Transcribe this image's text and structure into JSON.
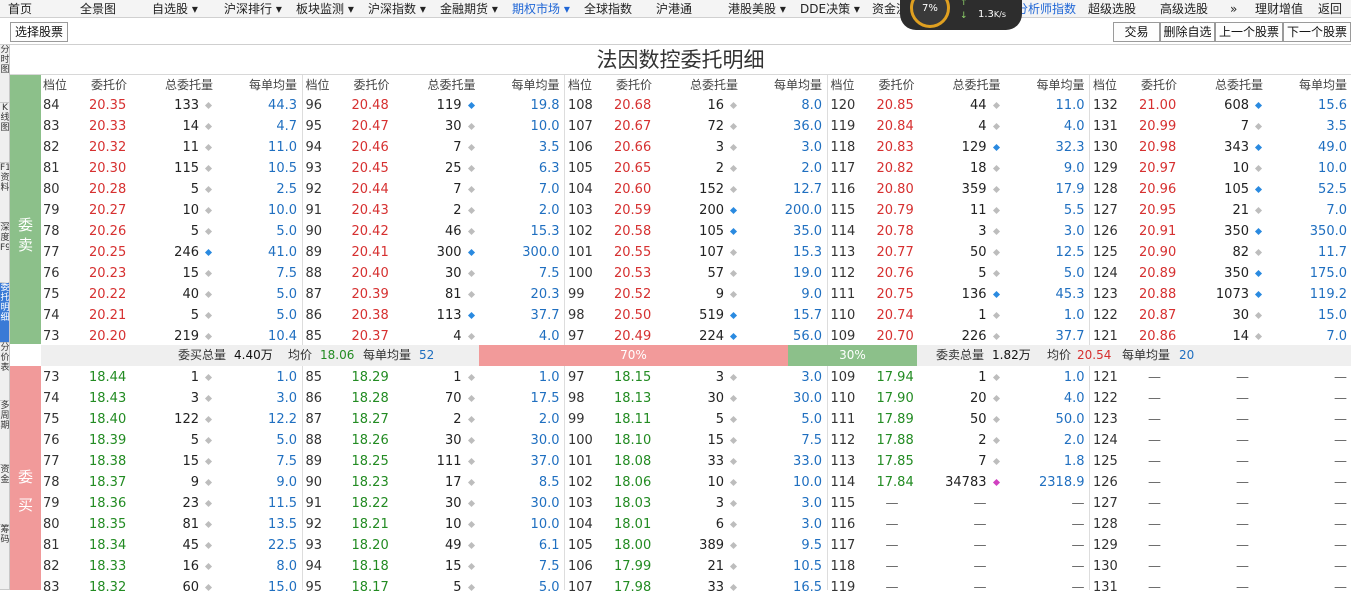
{
  "menu": [
    "首页",
    "全景图",
    "自选股 ▾",
    "沪深排行 ▾",
    "板块监测 ▾",
    "沪深指数 ▾",
    "金融期货 ▾",
    "期权市场 ▾",
    "全球指数",
    "沪港通",
    "港股美股 ▾",
    "DDE决策 ▾",
    "资金流",
    "分析师指数",
    "超级选股",
    "高级选股",
    "»",
    "理财增值",
    "返回"
  ],
  "net": {
    "percent": "7",
    "unit": "%",
    "speed": "1.3",
    "speed_unit": "K/s",
    "up": "↑",
    "down": "↓"
  },
  "toolbar": {
    "select_stock": "选择股票",
    "trade": "交易",
    "delete_watch": "删除自选",
    "prev_stock": "上一个股票",
    "next_stock": "下一个股票"
  },
  "sidebar": [
    "分时图",
    "K线图",
    "F10资料",
    "深度F9",
    "委托明细",
    "分价表",
    "多周期",
    "资金",
    "筹码"
  ],
  "title": "法因数控委托明细",
  "sell_label": [
    "委",
    "卖"
  ],
  "buy_label": [
    "委",
    "买"
  ],
  "headers": [
    "档位",
    "委托价",
    "总委托量",
    "每单均量"
  ],
  "sell": [
    [
      [
        "84",
        "20.35",
        "133",
        "g",
        "44.3"
      ],
      [
        "96",
        "20.48",
        "119",
        "b",
        "19.8"
      ],
      [
        "108",
        "20.68",
        "16",
        "g",
        "8.0"
      ],
      [
        "120",
        "20.85",
        "44",
        "g",
        "11.0"
      ],
      [
        "132",
        "21.00",
        "608",
        "b",
        "15.6"
      ]
    ],
    [
      [
        "83",
        "20.33",
        "14",
        "g",
        "4.7"
      ],
      [
        "95",
        "20.47",
        "30",
        "g",
        "10.0"
      ],
      [
        "107",
        "20.67",
        "72",
        "g",
        "36.0"
      ],
      [
        "119",
        "20.84",
        "4",
        "g",
        "4.0"
      ],
      [
        "131",
        "20.99",
        "7",
        "g",
        "3.5"
      ]
    ],
    [
      [
        "82",
        "20.32",
        "11",
        "g",
        "11.0"
      ],
      [
        "94",
        "20.46",
        "7",
        "g",
        "3.5"
      ],
      [
        "106",
        "20.66",
        "3",
        "g",
        "3.0"
      ],
      [
        "118",
        "20.83",
        "129",
        "b",
        "32.3"
      ],
      [
        "130",
        "20.98",
        "343",
        "b",
        "49.0"
      ]
    ],
    [
      [
        "81",
        "20.30",
        "115",
        "g",
        "10.5"
      ],
      [
        "93",
        "20.45",
        "25",
        "g",
        "6.3"
      ],
      [
        "105",
        "20.65",
        "2",
        "g",
        "2.0"
      ],
      [
        "117",
        "20.82",
        "18",
        "g",
        "9.0"
      ],
      [
        "129",
        "20.97",
        "10",
        "g",
        "10.0"
      ]
    ],
    [
      [
        "80",
        "20.28",
        "5",
        "g",
        "2.5"
      ],
      [
        "92",
        "20.44",
        "7",
        "g",
        "7.0"
      ],
      [
        "104",
        "20.60",
        "152",
        "g",
        "12.7"
      ],
      [
        "116",
        "20.80",
        "359",
        "g",
        "17.9"
      ],
      [
        "128",
        "20.96",
        "105",
        "b",
        "52.5"
      ]
    ],
    [
      [
        "79",
        "20.27",
        "10",
        "g",
        "10.0"
      ],
      [
        "91",
        "20.43",
        "2",
        "g",
        "2.0"
      ],
      [
        "103",
        "20.59",
        "200",
        "b",
        "200.0"
      ],
      [
        "115",
        "20.79",
        "11",
        "g",
        "5.5"
      ],
      [
        "127",
        "20.95",
        "21",
        "g",
        "7.0"
      ]
    ],
    [
      [
        "78",
        "20.26",
        "5",
        "g",
        "5.0"
      ],
      [
        "90",
        "20.42",
        "46",
        "g",
        "15.3"
      ],
      [
        "102",
        "20.58",
        "105",
        "b",
        "35.0"
      ],
      [
        "114",
        "20.78",
        "3",
        "g",
        "3.0"
      ],
      [
        "126",
        "20.91",
        "350",
        "b",
        "350.0"
      ]
    ],
    [
      [
        "77",
        "20.25",
        "246",
        "b",
        "41.0"
      ],
      [
        "89",
        "20.41",
        "300",
        "b",
        "300.0"
      ],
      [
        "101",
        "20.55",
        "107",
        "g",
        "15.3"
      ],
      [
        "113",
        "20.77",
        "50",
        "g",
        "12.5"
      ],
      [
        "125",
        "20.90",
        "82",
        "g",
        "11.7"
      ]
    ],
    [
      [
        "76",
        "20.23",
        "15",
        "g",
        "7.5"
      ],
      [
        "88",
        "20.40",
        "30",
        "g",
        "7.5"
      ],
      [
        "100",
        "20.53",
        "57",
        "g",
        "19.0"
      ],
      [
        "112",
        "20.76",
        "5",
        "g",
        "5.0"
      ],
      [
        "124",
        "20.89",
        "350",
        "b",
        "175.0"
      ]
    ],
    [
      [
        "75",
        "20.22",
        "40",
        "g",
        "5.0"
      ],
      [
        "87",
        "20.39",
        "81",
        "g",
        "20.3"
      ],
      [
        "99",
        "20.52",
        "9",
        "g",
        "9.0"
      ],
      [
        "111",
        "20.75",
        "136",
        "b",
        "45.3"
      ],
      [
        "123",
        "20.88",
        "1073",
        "b",
        "119.2"
      ]
    ],
    [
      [
        "74",
        "20.21",
        "5",
        "g",
        "5.0"
      ],
      [
        "86",
        "20.38",
        "113",
        "b",
        "37.7"
      ],
      [
        "98",
        "20.50",
        "519",
        "b",
        "15.7"
      ],
      [
        "110",
        "20.74",
        "1",
        "g",
        "1.0"
      ],
      [
        "122",
        "20.87",
        "30",
        "g",
        "15.0"
      ]
    ],
    [
      [
        "73",
        "20.20",
        "219",
        "g",
        "10.4"
      ],
      [
        "85",
        "20.37",
        "4",
        "g",
        "4.0"
      ],
      [
        "97",
        "20.49",
        "224",
        "b",
        "56.0"
      ],
      [
        "109",
        "20.70",
        "226",
        "g",
        "37.7"
      ],
      [
        "121",
        "20.86",
        "14",
        "g",
        "7.0"
      ]
    ]
  ],
  "summary": {
    "sell_total_label": "委买总量",
    "sell_total": "4.40万",
    "sell_avg_label": "均价",
    "sell_avg": "18.06",
    "sell_per_label": "每单均量",
    "sell_per": "52",
    "buy_pct": "70%",
    "sell_pct": "30%",
    "buy_total_label": "委卖总量",
    "buy_total": "1.82万",
    "buy_avg_label": "均价",
    "buy_avg": "20.54",
    "buy_per_label": "每单均量",
    "buy_per": "20",
    "left_share": 0.7,
    "right_share": 0.3
  },
  "buy": [
    [
      [
        "73",
        "18.44",
        "1",
        "g",
        "1.0"
      ],
      [
        "85",
        "18.29",
        "1",
        "g",
        "1.0"
      ],
      [
        "97",
        "18.15",
        "3",
        "g",
        "3.0"
      ],
      [
        "109",
        "17.94",
        "1",
        "g",
        "1.0"
      ],
      [
        "121",
        "—",
        "—",
        "",
        "—"
      ]
    ],
    [
      [
        "74",
        "18.43",
        "3",
        "g",
        "3.0"
      ],
      [
        "86",
        "18.28",
        "70",
        "g",
        "17.5"
      ],
      [
        "98",
        "18.13",
        "30",
        "g",
        "30.0"
      ],
      [
        "110",
        "17.90",
        "20",
        "g",
        "4.0"
      ],
      [
        "122",
        "—",
        "—",
        "",
        "—"
      ]
    ],
    [
      [
        "75",
        "18.40",
        "122",
        "g",
        "12.2"
      ],
      [
        "87",
        "18.27",
        "2",
        "g",
        "2.0"
      ],
      [
        "99",
        "18.11",
        "5",
        "g",
        "5.0"
      ],
      [
        "111",
        "17.89",
        "50",
        "g",
        "50.0"
      ],
      [
        "123",
        "—",
        "—",
        "",
        "—"
      ]
    ],
    [
      [
        "76",
        "18.39",
        "5",
        "g",
        "5.0"
      ],
      [
        "88",
        "18.26",
        "30",
        "g",
        "30.0"
      ],
      [
        "100",
        "18.10",
        "15",
        "g",
        "7.5"
      ],
      [
        "112",
        "17.88",
        "2",
        "g",
        "2.0"
      ],
      [
        "124",
        "—",
        "—",
        "",
        "—"
      ]
    ],
    [
      [
        "77",
        "18.38",
        "15",
        "g",
        "7.5"
      ],
      [
        "89",
        "18.25",
        "111",
        "g",
        "37.0"
      ],
      [
        "101",
        "18.08",
        "33",
        "g",
        "33.0"
      ],
      [
        "113",
        "17.85",
        "7",
        "g",
        "1.8"
      ],
      [
        "125",
        "—",
        "—",
        "",
        "—"
      ]
    ],
    [
      [
        "78",
        "18.37",
        "9",
        "g",
        "9.0"
      ],
      [
        "90",
        "18.23",
        "17",
        "g",
        "8.5"
      ],
      [
        "102",
        "18.06",
        "10",
        "g",
        "10.0"
      ],
      [
        "114",
        "17.84",
        "34783",
        "p",
        "2318.9"
      ],
      [
        "126",
        "—",
        "—",
        "",
        "—"
      ]
    ],
    [
      [
        "79",
        "18.36",
        "23",
        "g",
        "11.5"
      ],
      [
        "91",
        "18.22",
        "30",
        "g",
        "30.0"
      ],
      [
        "103",
        "18.03",
        "3",
        "g",
        "3.0"
      ],
      [
        "115",
        "—",
        "—",
        "",
        "—"
      ],
      [
        "127",
        "—",
        "—",
        "",
        "—"
      ]
    ],
    [
      [
        "80",
        "18.35",
        "81",
        "g",
        "13.5"
      ],
      [
        "92",
        "18.21",
        "10",
        "g",
        "10.0"
      ],
      [
        "104",
        "18.01",
        "6",
        "g",
        "3.0"
      ],
      [
        "116",
        "—",
        "—",
        "",
        "—"
      ],
      [
        "128",
        "—",
        "—",
        "",
        "—"
      ]
    ],
    [
      [
        "81",
        "18.34",
        "45",
        "g",
        "22.5"
      ],
      [
        "93",
        "18.20",
        "49",
        "g",
        "6.1"
      ],
      [
        "105",
        "18.00",
        "389",
        "g",
        "9.5"
      ],
      [
        "117",
        "—",
        "—",
        "",
        "—"
      ],
      [
        "129",
        "—",
        "—",
        "",
        "—"
      ]
    ],
    [
      [
        "82",
        "18.33",
        "16",
        "g",
        "8.0"
      ],
      [
        "94",
        "18.18",
        "15",
        "g",
        "7.5"
      ],
      [
        "106",
        "17.99",
        "21",
        "g",
        "10.5"
      ],
      [
        "118",
        "—",
        "—",
        "",
        "—"
      ],
      [
        "130",
        "—",
        "—",
        "",
        "—"
      ]
    ],
    [
      [
        "83",
        "18.32",
        "60",
        "g",
        "15.0"
      ],
      [
        "95",
        "18.17",
        "5",
        "g",
        "5.0"
      ],
      [
        "107",
        "17.98",
        "33",
        "g",
        "16.5"
      ],
      [
        "119",
        "—",
        "—",
        "",
        "—"
      ],
      [
        "131",
        "—",
        "—",
        "",
        "—"
      ]
    ]
  ]
}
